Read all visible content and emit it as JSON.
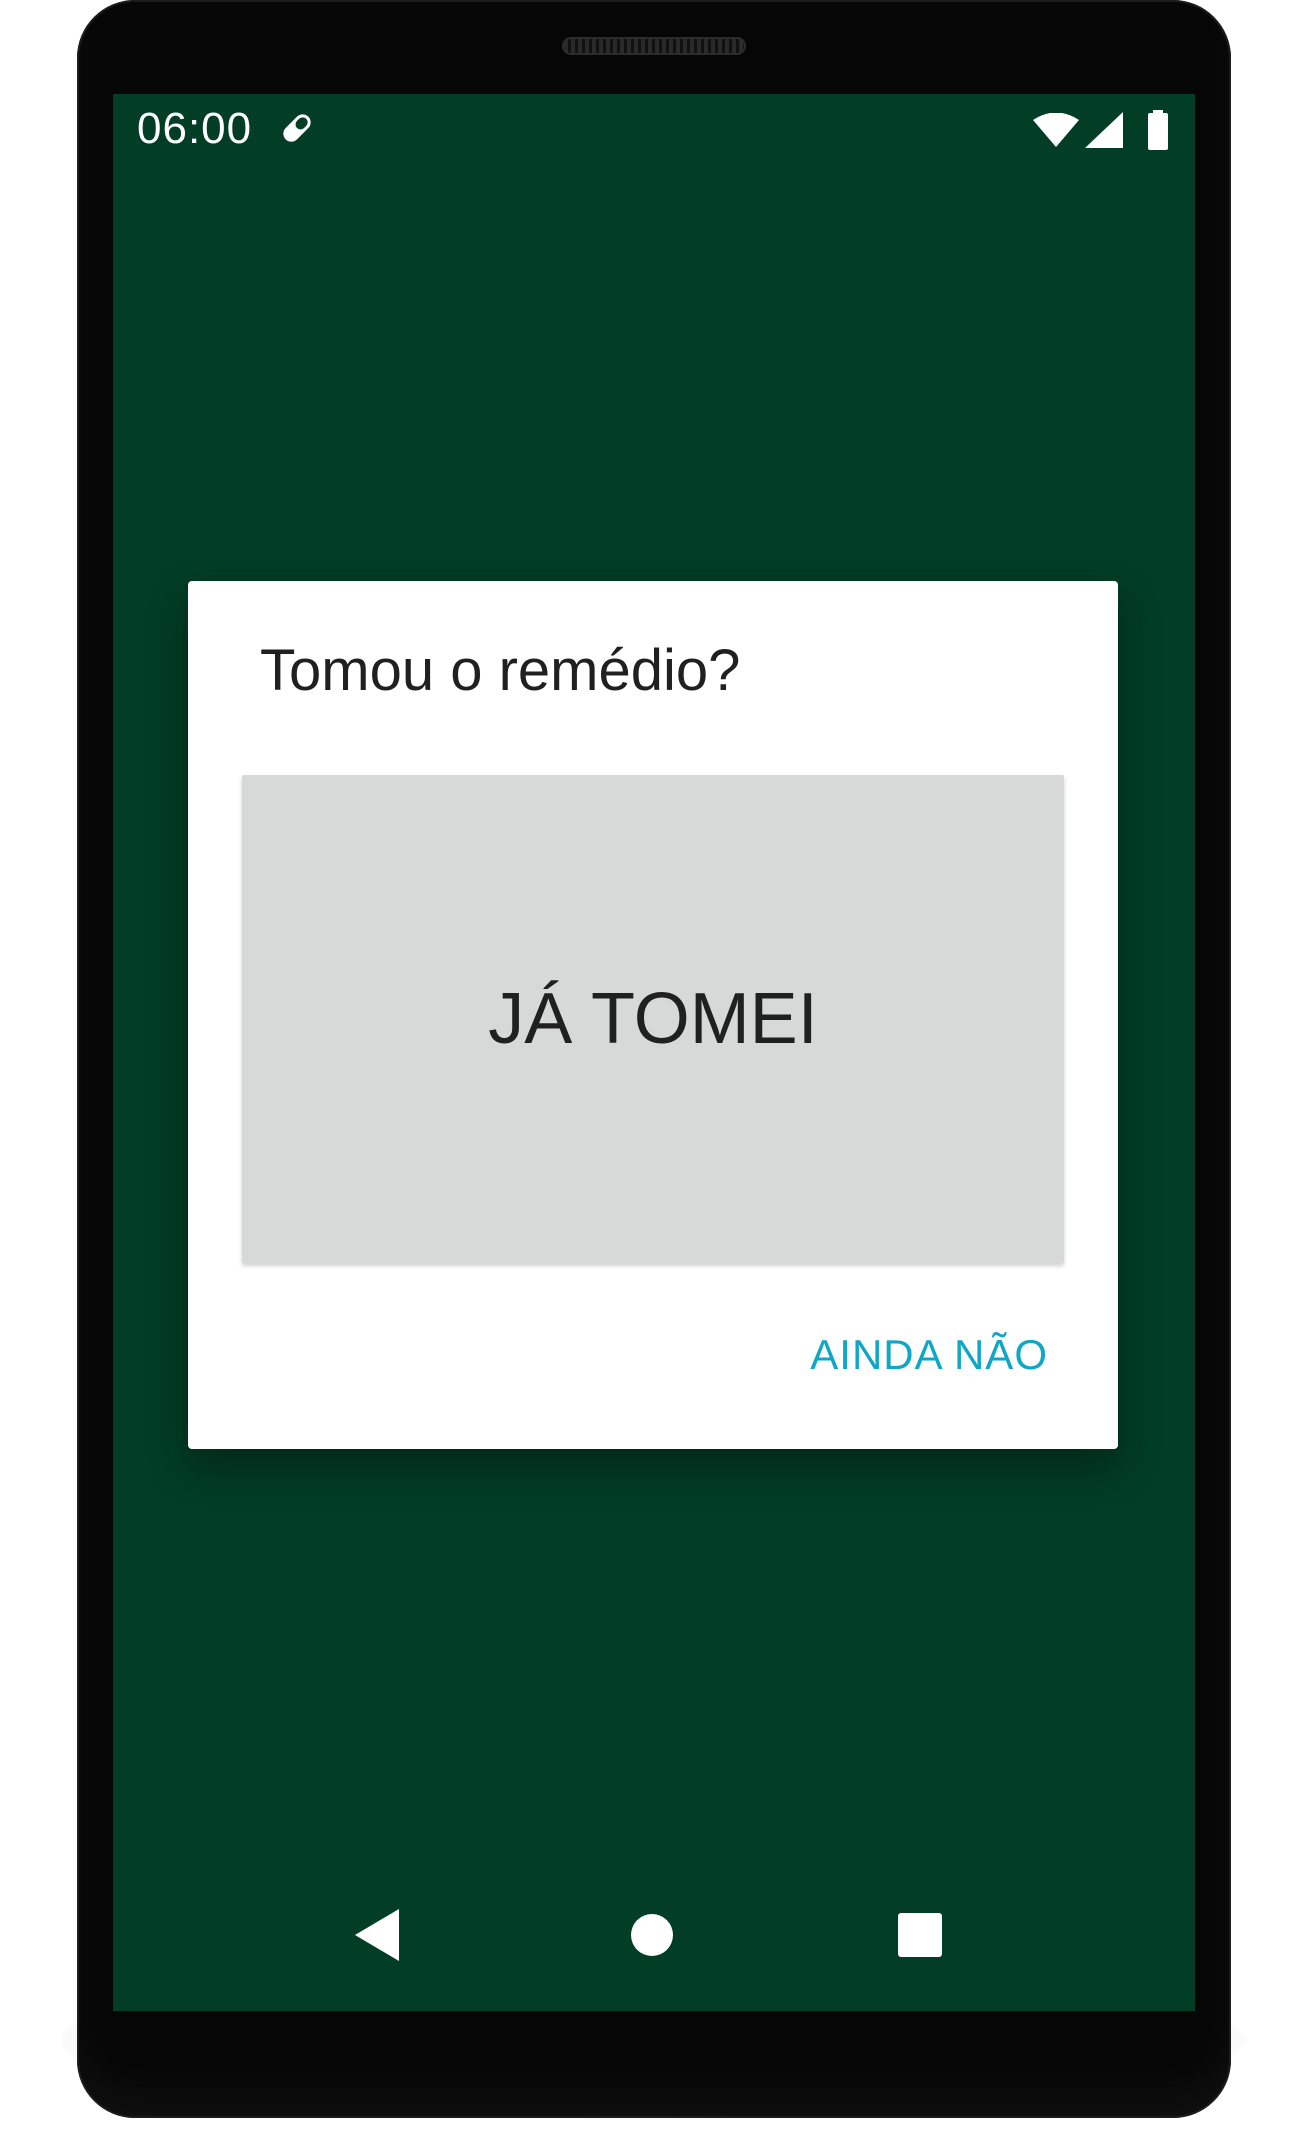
{
  "status_bar": {
    "time": "06:00",
    "notification_icon": "pill-icon",
    "wifi_icon": "wifi-icon",
    "signal_icon": "cell-signal-icon",
    "battery_icon": "battery-icon"
  },
  "dialog": {
    "title": "Tomou o remédio?",
    "primary_button_label": "JÁ TOMEI",
    "secondary_button_label": "AINDA NÃO"
  },
  "nav_bar": {
    "back_icon": "back-triangle-icon",
    "home_icon": "home-circle-icon",
    "recents_icon": "recents-square-icon"
  },
  "colors": {
    "screen_background": "#023d26",
    "dialog_background": "#ffffff",
    "primary_button_background": "#d7d8d8",
    "secondary_button_text": "#0fa7c8",
    "title_text": "#202020"
  }
}
